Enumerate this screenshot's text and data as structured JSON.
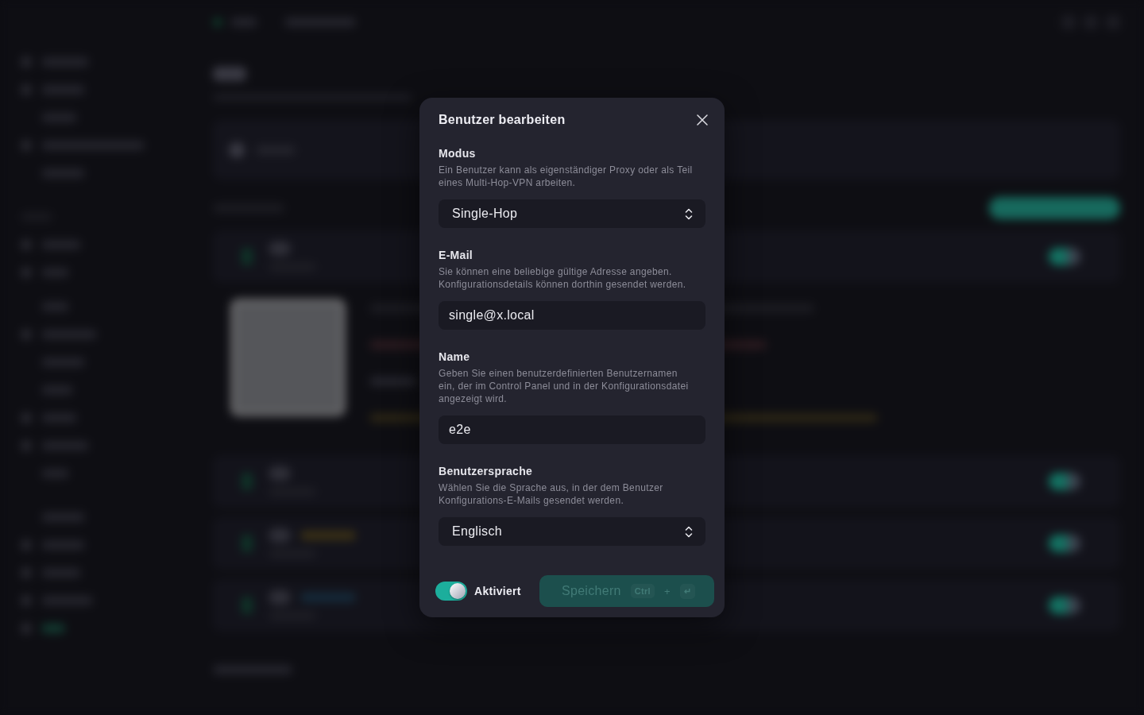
{
  "dialog": {
    "title": "Benutzer bearbeiten",
    "fields": [
      {
        "kind": "select",
        "label": "Modus",
        "description": "Ein Benutzer kann als eigenständiger Proxy oder als Teil eines Multi-Hop-VPN arbeiten.",
        "value": "Single-Hop"
      },
      {
        "kind": "text",
        "label": "E-Mail",
        "description": "Sie können eine beliebige gültige Adresse angeben. Konfigurationsdetails können dorthin gesendet werden.",
        "value": "single@x.local"
      },
      {
        "kind": "text",
        "label": "Name",
        "description": "Geben Sie einen benutzerdefinierten Benutzernamen ein, der im Control Panel und in der Konfigurationsdatei angezeigt wird.",
        "value": "e2e"
      },
      {
        "kind": "select",
        "label": "Benutzersprache",
        "description": "Wählen Sie die Sprache aus, in der dem Benutzer Konfigurations-E-Mails gesendet werden.",
        "value": "Englisch"
      }
    ],
    "enabled_switch": {
      "label": "Aktiviert",
      "on": true
    },
    "save_button": {
      "label": "Speichern",
      "disabled": true,
      "shortcut": [
        {
          "kind": "key",
          "text": "Ctrl"
        },
        {
          "kind": "separator",
          "text": "+"
        },
        {
          "kind": "key",
          "text": "↵"
        }
      ]
    }
  }
}
